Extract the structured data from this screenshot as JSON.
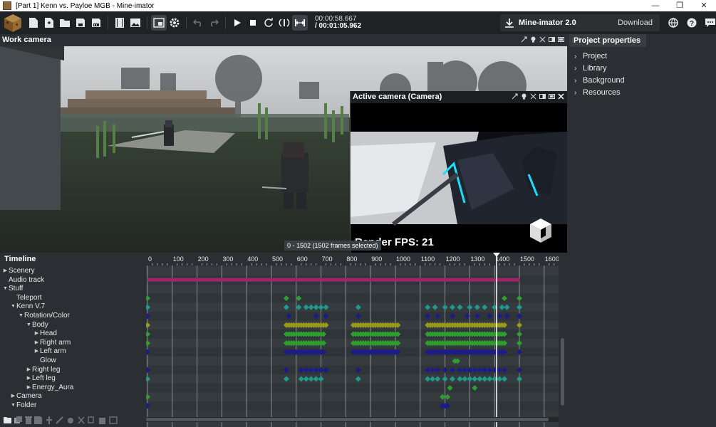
{
  "window": {
    "title": "[Part 1] Kenn vs. Payloe MGB - Mine-imator",
    "controls": [
      "—",
      "❐",
      "✕"
    ]
  },
  "toolbar": {
    "timecode_current": "00:00:58.667",
    "timecode_total": "/ 00:01:05.962",
    "version_label": "Mine-imator 2.0",
    "download_label": "Download"
  },
  "work_camera": {
    "title": "Work camera"
  },
  "active_camera": {
    "title": "Active camera (Camera)",
    "fps_label": "Render FPS: 21"
  },
  "project_properties": {
    "title": "Project properties",
    "items": [
      {
        "label": "Project"
      },
      {
        "label": "Library"
      },
      {
        "label": "Background"
      },
      {
        "label": "Resources"
      }
    ]
  },
  "timeline": {
    "title": "Timeline",
    "selection_tooltip": "0 - 1502 (1502 frames selected)",
    "ruler_labels": [
      "0",
      "100",
      "200",
      "300",
      "400",
      "500",
      "600",
      "700",
      "800",
      "900",
      "1000",
      "1100",
      "1200",
      "1300",
      "1400",
      "1500",
      "1600"
    ],
    "playhead_frame": 1408,
    "tracks": [
      {
        "label": "Scenery",
        "arrow": "right",
        "indent": 0
      },
      {
        "label": "Audio track",
        "arrow": "",
        "indent": 0
      },
      {
        "label": "Stuff",
        "arrow": "down",
        "indent": 0
      },
      {
        "label": "Teleport",
        "arrow": "",
        "indent": 1
      },
      {
        "label": "Kenn V.7",
        "arrow": "down",
        "indent": 1
      },
      {
        "label": "Rotation/Color",
        "arrow": "down",
        "indent": 2
      },
      {
        "label": "Body",
        "arrow": "down",
        "indent": 3
      },
      {
        "label": "Head",
        "arrow": "right",
        "indent": 4
      },
      {
        "label": "Right arm",
        "arrow": "right",
        "indent": 4
      },
      {
        "label": "Left arm",
        "arrow": "right",
        "indent": 4
      },
      {
        "label": "Glow",
        "arrow": "",
        "indent": 4
      },
      {
        "label": "Right leg",
        "arrow": "right",
        "indent": 3
      },
      {
        "label": "Left leg",
        "arrow": "right",
        "indent": 3
      },
      {
        "label": "Energy_Aura",
        "arrow": "right",
        "indent": 3
      },
      {
        "label": "Camera",
        "arrow": "right",
        "indent": 1
      },
      {
        "label": "Folder",
        "arrow": "down",
        "indent": 1
      }
    ]
  },
  "colors": {
    "green": "#2f9e2f",
    "teal": "#1f9a8a",
    "navy": "#1d1a8c",
    "olive": "#9a9a1a",
    "magenta": "#a0246a",
    "playhead": "#ffffff"
  }
}
